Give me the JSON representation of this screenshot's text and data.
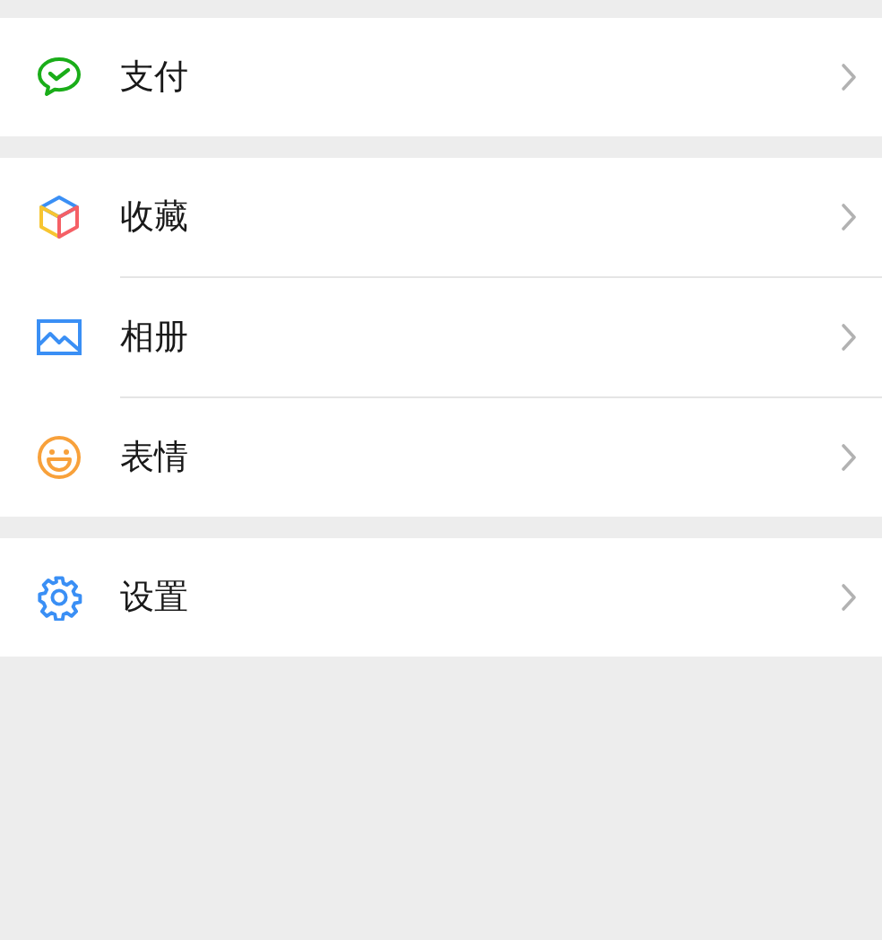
{
  "groups": [
    {
      "items": [
        {
          "kind": "pay",
          "label": "支付"
        }
      ]
    },
    {
      "items": [
        {
          "kind": "favorites",
          "label": "收藏"
        },
        {
          "kind": "album",
          "label": "相册"
        },
        {
          "kind": "stickers",
          "label": "表情"
        }
      ]
    },
    {
      "items": [
        {
          "kind": "settings",
          "label": "设置"
        }
      ]
    }
  ]
}
